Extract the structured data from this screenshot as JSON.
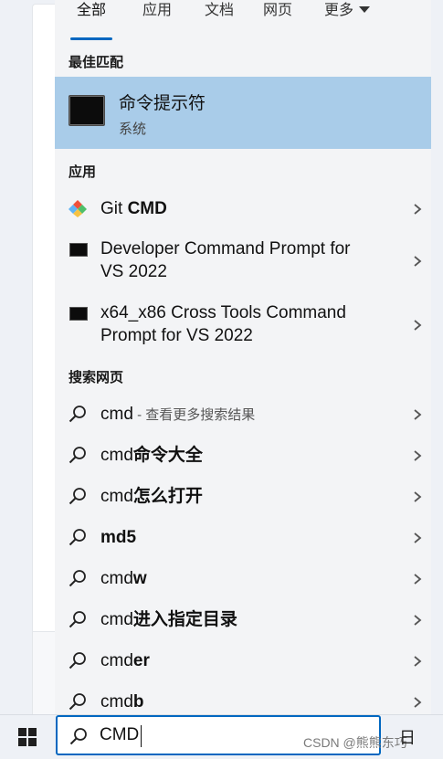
{
  "tabs": [
    {
      "label": "全部",
      "active": true
    },
    {
      "label": "应用"
    },
    {
      "label": "文档"
    },
    {
      "label": "网页"
    },
    {
      "label": "更多"
    }
  ],
  "best_match": {
    "header": "最佳匹配",
    "title": "命令提示符",
    "subtitle": "系统",
    "icon": "terminal-icon"
  },
  "apps": {
    "header": "应用",
    "items": [
      {
        "prefix": "Git ",
        "bold": "CMD",
        "icon": "git-icon"
      },
      {
        "line1": "Developer Command Prompt for",
        "line2": "VS 2022",
        "icon": "terminal-icon"
      },
      {
        "line1": "x64_x86 Cross Tools Command",
        "line2": "Prompt for VS 2022",
        "icon": "terminal-icon"
      }
    ]
  },
  "web": {
    "header": "搜索网页",
    "items": [
      {
        "plain": "cmd",
        "bold": "",
        "suffix": " - 查看更多搜索结果"
      },
      {
        "plain": "cmd",
        "bold": "命令大全"
      },
      {
        "plain": "cmd",
        "bold": "怎么打开"
      },
      {
        "plain": "",
        "bold": "md5"
      },
      {
        "plain": "cmd",
        "bold": "w"
      },
      {
        "plain": "cmd",
        "bold": "进入指定目录"
      },
      {
        "plain": "cmd",
        "bold": "er"
      },
      {
        "plain": "cmd",
        "bold": "b"
      }
    ]
  },
  "taskbar": {
    "search_value": "CMD",
    "watermark": "CSDN @熊熊东巧",
    "right_text": "日"
  },
  "colors": {
    "accent": "#0067c0",
    "highlight": "#a9cce9",
    "panel": "#f3f4f6"
  }
}
